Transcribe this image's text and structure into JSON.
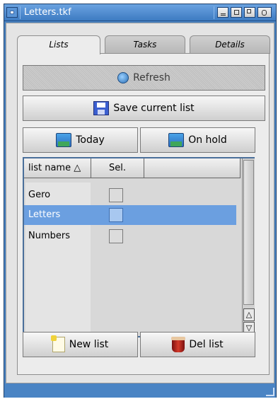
{
  "window": {
    "title": "Letters.tkf"
  },
  "tabs": [
    {
      "label": "Lists"
    },
    {
      "label": "Tasks"
    },
    {
      "label": "Details"
    }
  ],
  "buttons": {
    "refresh": "Refresh",
    "save": "Save current list",
    "today": "Today",
    "on_hold": "On hold",
    "new_list": "New list",
    "del_list": "Del list"
  },
  "list": {
    "columns": [
      "list name △",
      "Sel.",
      ""
    ],
    "rows": [
      {
        "name": "Gero",
        "selected": false
      },
      {
        "name": "Letters",
        "selected": true
      },
      {
        "name": "Numbers",
        "selected": false
      }
    ]
  },
  "icons": {
    "refresh": "refresh-icon",
    "save": "disk-icon",
    "today": "box-icon",
    "on_hold": "box-icon",
    "new_list": "note-icon",
    "del_list": "bin-icon"
  },
  "colors": {
    "titlebar": "#3d7bc2",
    "selection": "#6b9fe0"
  }
}
